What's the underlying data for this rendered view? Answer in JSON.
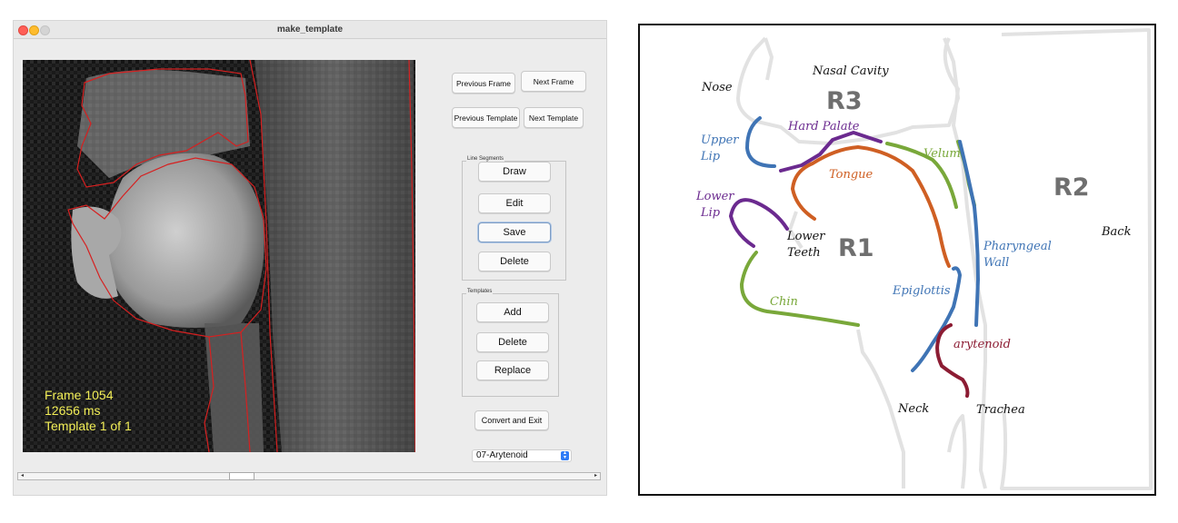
{
  "window": {
    "title": "make_template"
  },
  "viewer": {
    "frame_text": "Frame 1054",
    "time_text": "12656 ms",
    "template_text": "Template 1 of 1"
  },
  "navigation": {
    "previous_frame": "Previous Frame",
    "next_frame": "Next Frame",
    "previous_template": "Previous Template",
    "next_template": "Next Template"
  },
  "line_segments": {
    "group_label": "Line Segments",
    "draw": "Draw",
    "edit": "Edit",
    "save": "Save",
    "delete": "Delete"
  },
  "templates": {
    "group_label": "Templates",
    "add": "Add",
    "delete": "Delete",
    "replace": "Replace"
  },
  "actions": {
    "convert_and_exit": "Convert and Exit"
  },
  "segment_select": {
    "value": "07-Arytenoid"
  },
  "diagram": {
    "regions": {
      "r1": "R1",
      "r2": "R2",
      "r3": "R3"
    },
    "labels": {
      "nasal_cavity": "Nasal Cavity",
      "nose": "Nose",
      "hard_palate": "Hard Palate",
      "upper": "Upper",
      "lip_upper": "Lip",
      "velum": "Velum",
      "tongue": "Tongue",
      "lower": "Lower",
      "lip_lower": "Lip",
      "lower_teeth_1": "Lower",
      "lower_teeth_2": "Teeth",
      "pharyngeal": "Pharyngeal",
      "wall": "Wall",
      "back": "Back",
      "epiglottis": "Epiglottis",
      "chin": "Chin",
      "arytenoid": "arytenoid",
      "neck": "Neck",
      "trachea": "Trachea"
    },
    "colors": {
      "purple": "#6b2a8f",
      "blue": "#3f74b5",
      "green": "#79a83a",
      "orange": "#cf5f23",
      "maroon": "#8c1c33",
      "outline": "#e2e2e2",
      "region": "#6f6f6f"
    }
  }
}
